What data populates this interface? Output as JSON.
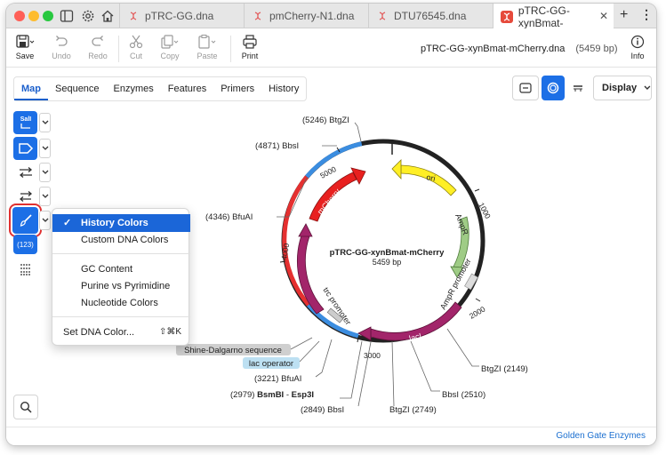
{
  "tabs": [
    {
      "label": "pTRC-GG.dna"
    },
    {
      "label": "pmCherry-N1.dna"
    },
    {
      "label": "DTU76545.dna"
    },
    {
      "label": "pTRC-GG-xynBmat-"
    }
  ],
  "toolbar": {
    "save": "Save",
    "undo": "Undo",
    "redo": "Redo",
    "cut": "Cut",
    "copy": "Copy",
    "paste": "Paste",
    "print": "Print",
    "info": "Info"
  },
  "file": {
    "title": "pTRC-GG-xynBmat-mCherry.dna",
    "size": "(5459 bp)"
  },
  "subtabs": [
    "Map",
    "Sequence",
    "Enzymes",
    "Features",
    "Primers",
    "History"
  ],
  "display_label": "Display",
  "side": {
    "sall": "SalI",
    "count": "(123)"
  },
  "menu": {
    "items": [
      "History Colors",
      "Custom DNA Colors",
      "GC Content",
      "Purine vs Pyrimidine",
      "Nucleotide Colors",
      "Set DNA Color..."
    ],
    "checkmark": "✓",
    "shortcut": "⇧⌘K"
  },
  "map": {
    "name": "pTRC-GG-xynBmat-mCherry",
    "length": "5459 bp",
    "features": [
      "ori",
      "AmpR",
      "AmpR promoter",
      "lacI",
      "xynB",
      "trc promoter",
      "mCherry"
    ],
    "ticks": [
      "1000",
      "2000",
      "3000",
      "4000",
      "5000"
    ],
    "sites": [
      {
        "pos": "(5246)",
        "name": "BtgZI"
      },
      {
        "pos": "(4871)",
        "name": "BbsI"
      },
      {
        "pos": "(4346)",
        "name": "BfuAI"
      },
      {
        "pos": "BtgZI",
        "name": "(2149)"
      },
      {
        "pos": "BbsI",
        "name": "(2510)"
      },
      {
        "pos": "BtgZI",
        "name": "(2749)"
      },
      {
        "pos": "(2849)",
        "name": "BbsI"
      },
      {
        "pos": "(2979)",
        "name": "BsmBI"
      },
      {
        "pos": "-",
        "name": "Esp3I"
      },
      {
        "pos": "(3221)",
        "name": "BfuAI"
      }
    ],
    "labels": {
      "shine": "Shine-Dalgarno sequence",
      "lacop": "lac operator"
    }
  },
  "status": "Golden Gate Enzymes"
}
